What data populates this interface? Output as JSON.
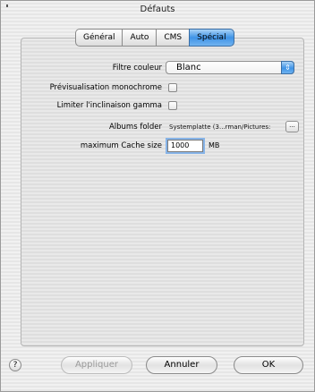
{
  "window": {
    "title": "Défauts"
  },
  "tabs": [
    {
      "label": "Général",
      "active": false
    },
    {
      "label": "Auto",
      "active": false
    },
    {
      "label": "CMS",
      "active": false
    },
    {
      "label": "Spécial",
      "active": true
    }
  ],
  "settings": {
    "color_filter": {
      "label": "Filtre couleur",
      "value": "Blanc"
    },
    "mono_preview": {
      "label": "Prévisualisation monochrome",
      "checked": false
    },
    "gamma_limit": {
      "label": "Limiter l'inclinaison gamma",
      "checked": false
    },
    "albums_folder": {
      "label": "Albums folder",
      "value": "Systemplatte (3...rman/Pictures:",
      "browse_label": "..."
    },
    "cache_size": {
      "label": "maximum Cache size",
      "value": "1000",
      "unit": "MB"
    }
  },
  "footer": {
    "help_icon": "?",
    "apply_label": "Appliquer",
    "cancel_label": "Annuler",
    "ok_label": "OK"
  }
}
